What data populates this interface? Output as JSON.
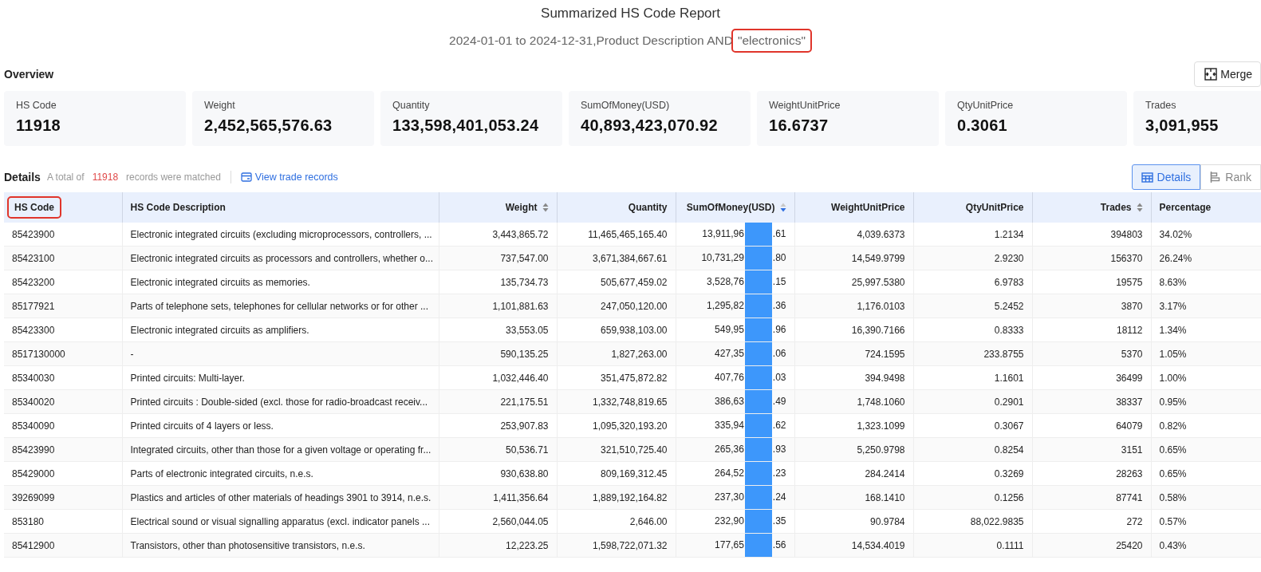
{
  "report": {
    "title": "Summarized HS Code Report",
    "subtitle": "2024-01-01 to 2024-12-31,Product Description AND ",
    "keyword": "\"electronics\"",
    "keyword_highlighted": true
  },
  "overview": {
    "label": "Overview",
    "merge_button": "Merge",
    "cards": [
      {
        "label": "HS Code",
        "value": "11918"
      },
      {
        "label": "Weight",
        "value": "2,452,565,576.63"
      },
      {
        "label": "Quantity",
        "value": "133,598,401,053.24"
      },
      {
        "label": "SumOfMoney(USD)",
        "value": "40,893,423,070.92"
      },
      {
        "label": "WeightUnitPrice",
        "value": "16.6737"
      },
      {
        "label": "QtyUnitPrice",
        "value": "0.3061"
      },
      {
        "label": "Trades",
        "value": "3,091,955"
      }
    ]
  },
  "details": {
    "label": "Details",
    "total_prefix": "A total of",
    "total_count": "11918",
    "total_suffix": "records were matched",
    "link": "View trade records",
    "views": [
      {
        "label": "Details",
        "selected": true
      },
      {
        "label": "Rank",
        "selected": false
      }
    ]
  },
  "table": {
    "columns": [
      {
        "label": "HS Code",
        "highlighted": true
      },
      {
        "label": "HS Code Description",
        "highlighted": false
      },
      {
        "label": "Weight",
        "sorted_desc": false,
        "highlighted": false
      },
      {
        "label": "Quantity",
        "highlighted": false
      },
      {
        "label": "SumOfMoney(USD)",
        "sorted_desc": true,
        "highlighted": false
      },
      {
        "label": "WeightUnitPrice",
        "highlighted": false
      },
      {
        "label": "QtyUnitPrice",
        "highlighted": false
      },
      {
        "label": "Trades",
        "sorted_desc": false,
        "highlighted": false
      },
      {
        "label": "Percentage",
        "highlighted": false
      }
    ],
    "rows": [
      {
        "cells": [
          "85423900",
          "Electronic integrated circuits (excluding microprocessors, controllers, ...",
          "3,443,865.72",
          "11,465,465,165.40",
          [
            "13,911,96",
            ".61"
          ],
          "4,039.6373",
          "1.2134",
          "394803",
          "34.02%"
        ]
      },
      {
        "cells": [
          "85423100",
          "Electronic integrated circuits as processors and controllers, whether o...",
          "737,547.00",
          "3,671,384,667.61",
          [
            "10,731,29",
            ".80"
          ],
          "14,549.9799",
          "2.9230",
          "156370",
          "26.24%"
        ]
      },
      {
        "cells": [
          "85423200",
          "Electronic integrated circuits as memories.",
          "135,734.73",
          "505,677,459.02",
          [
            "3,528,76",
            ".15"
          ],
          "25,997.5380",
          "6.9783",
          "19575",
          "8.63%"
        ]
      },
      {
        "cells": [
          "85177921",
          "Parts of telephone sets, telephones for cellular networks or for other ...",
          "1,101,881.63",
          "247,050,120.00",
          [
            "1,295,82",
            ".36"
          ],
          "1,176.0103",
          "5.2452",
          "3870",
          "3.17%"
        ]
      },
      {
        "cells": [
          "85423300",
          "Electronic integrated circuits as amplifiers.",
          "33,553.05",
          "659,938,103.00",
          [
            "549,95",
            ".96"
          ],
          "16,390.7166",
          "0.8333",
          "18112",
          "1.34%"
        ]
      },
      {
        "cells": [
          "8517130000",
          "-",
          "590,135.25",
          "1,827,263.00",
          [
            "427,35",
            ".06"
          ],
          "724.1595",
          "233.8755",
          "5370",
          "1.05%"
        ]
      },
      {
        "cells": [
          "85340030",
          "Printed circuits: Multi-layer.",
          "1,032,446.40",
          "351,475,872.82",
          [
            "407,76",
            ".03"
          ],
          "394.9498",
          "1.1601",
          "36499",
          "1.00%"
        ]
      },
      {
        "cells": [
          "85340020",
          "Printed circuits : Double-sided (excl. those for radio-broadcast receiv...",
          "221,175.51",
          "1,332,748,819.65",
          [
            "386,63",
            ".49"
          ],
          "1,748.1060",
          "0.2901",
          "38337",
          "0.95%"
        ]
      },
      {
        "cells": [
          "85340090",
          "Printed circuits of 4 layers or less.",
          "253,907.83",
          "1,095,320,193.20",
          [
            "335,94",
            ".62"
          ],
          "1,323.1099",
          "0.3067",
          "64079",
          "0.82%"
        ]
      },
      {
        "cells": [
          "85423990",
          "Integrated circuits, other than those for a given voltage or operating fr...",
          "50,536.71",
          "321,510,725.40",
          [
            "265,36",
            ".93"
          ],
          "5,250.9798",
          "0.8254",
          "3151",
          "0.65%"
        ]
      },
      {
        "cells": [
          "85429000",
          "Parts of electronic integrated circuits, n.e.s.",
          "930,638.80",
          "809,169,312.45",
          [
            "264,52",
            ".23"
          ],
          "284.2414",
          "0.3269",
          "28263",
          "0.65%"
        ]
      },
      {
        "cells": [
          "39269099",
          "Plastics and articles of other materials of headings 3901 to 3914, n.e.s.",
          "1,411,356.64",
          "1,889,192,164.82",
          [
            "237,30",
            ".24"
          ],
          "168.1410",
          "0.1256",
          "87741",
          "0.58%"
        ]
      },
      {
        "cells": [
          "853180",
          "Electrical sound or visual signalling apparatus (excl. indicator panels ...",
          "2,560,044.05",
          "2,646.00",
          [
            "232,90",
            ".35"
          ],
          "90.9784",
          "88,022.9835",
          "272",
          "0.57%"
        ]
      },
      {
        "cells": [
          "85412900",
          "Transistors, other than photosensitive transistors, n.e.s.",
          "12,223.25",
          "1,598,722,071.32",
          [
            "177,65",
            ".56"
          ],
          "14,534.4019",
          "0.1111",
          "25420",
          "0.43%"
        ]
      }
    ]
  }
}
